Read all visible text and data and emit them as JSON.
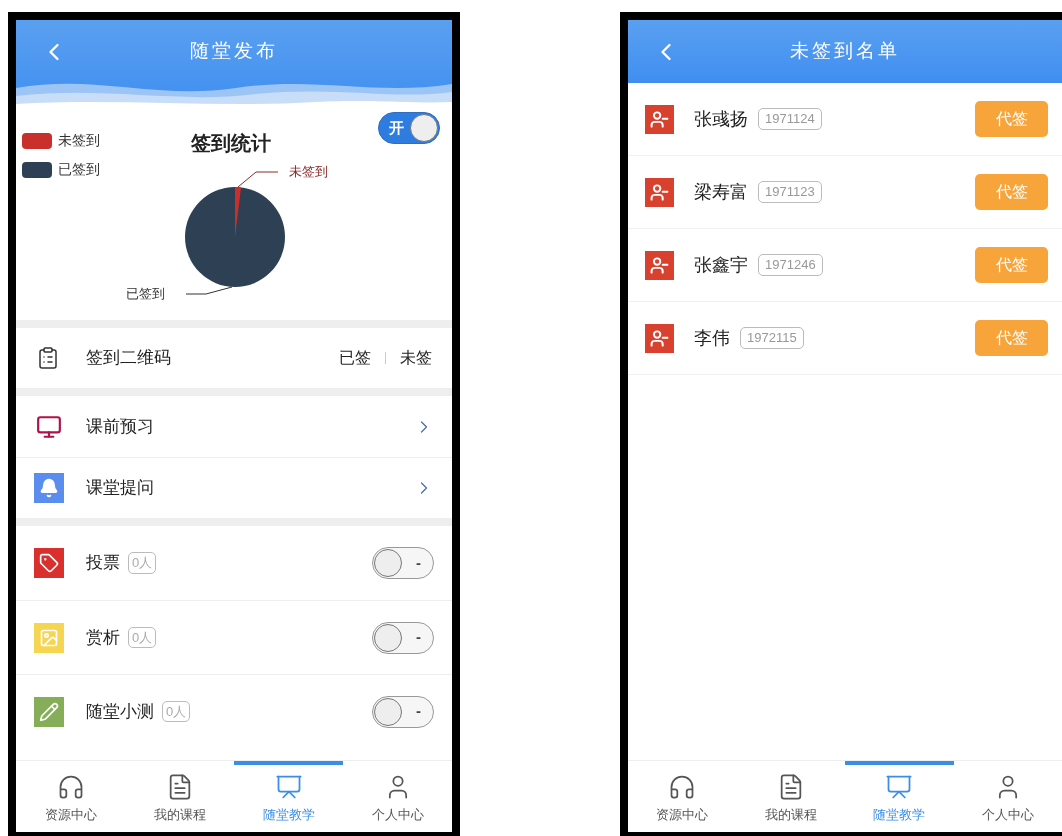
{
  "left_screen": {
    "header": {
      "title": "随堂发布"
    },
    "stats": {
      "title": "签到统计",
      "switch": {
        "label": "开",
        "on": true
      },
      "legend": [
        {
          "label": "未签到",
          "color": "#c9302c"
        },
        {
          "label": "已签到",
          "color": "#2e4053"
        }
      ],
      "pie_labels": [
        "未签到",
        "已签到"
      ]
    },
    "qr_row": {
      "label": "签到二维码",
      "links": [
        "已签",
        "未签"
      ]
    },
    "nav_rows": [
      {
        "kind": "monitor",
        "label": "课前预习"
      },
      {
        "kind": "bell",
        "label": "课堂提问"
      }
    ],
    "activities": [
      {
        "kind": "tag",
        "label": "投票",
        "count": "0人",
        "switch_label": "-",
        "on": false
      },
      {
        "kind": "image",
        "label": "赏析",
        "count": "0人",
        "switch_label": "-",
        "on": false
      },
      {
        "kind": "pencil",
        "label": "随堂小测",
        "count": "0人",
        "switch_label": "-",
        "on": false
      }
    ],
    "tab_bar": [
      {
        "kind": "headphones",
        "label": "资源中心",
        "selected": false
      },
      {
        "kind": "document",
        "label": "我的课程",
        "selected": false
      },
      {
        "kind": "presentation",
        "label": "随堂教学",
        "selected": true
      },
      {
        "kind": "person",
        "label": "个人中心",
        "selected": false
      }
    ]
  },
  "right_screen": {
    "header": {
      "title": "未签到名单"
    },
    "students": [
      {
        "name": "张彧扬",
        "id": "1971124",
        "button": "代签"
      },
      {
        "name": "梁寿富",
        "id": "1971123",
        "button": "代签"
      },
      {
        "name": "张鑫宇",
        "id": "1971246",
        "button": "代签"
      },
      {
        "name": "李伟",
        "id": "1972115",
        "button": "代签"
      }
    ],
    "tab_bar": [
      {
        "kind": "headphones",
        "label": "资源中心",
        "selected": false
      },
      {
        "kind": "document",
        "label": "我的课程",
        "selected": false
      },
      {
        "kind": "presentation",
        "label": "随堂教学",
        "selected": true
      },
      {
        "kind": "person",
        "label": "个人中心",
        "selected": false
      }
    ]
  }
}
